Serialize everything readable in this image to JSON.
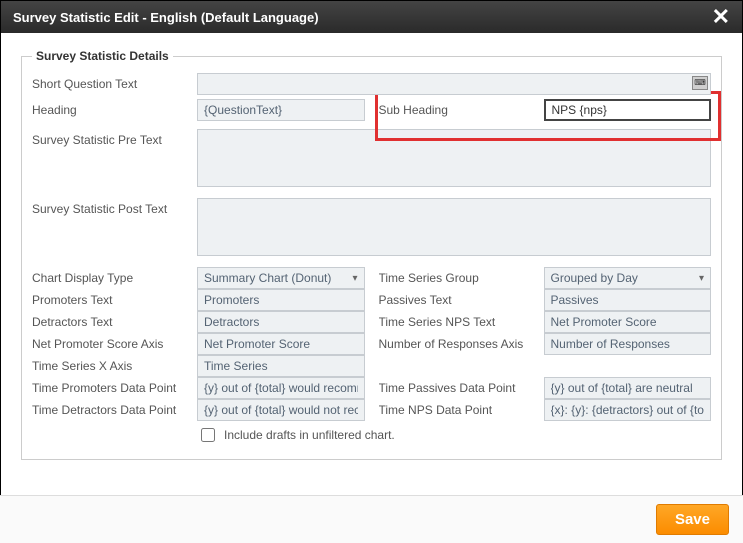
{
  "window": {
    "title": "Survey Statistic Edit  -  English (Default Language)"
  },
  "fieldset": {
    "legend": "Survey Statistic Details"
  },
  "labels": {
    "shortQuestion": "Short Question Text",
    "heading": "Heading",
    "subHeading": "Sub Heading",
    "preText": "Survey Statistic Pre Text",
    "postText": "Survey Statistic Post Text",
    "chartDisplayType": "Chart Display Type",
    "timeSeriesGroup": "Time Series Group",
    "promotersText": "Promoters Text",
    "passivesText": "Passives Text",
    "detractorsText": "Detractors Text",
    "timeSeriesNpsText": "Time Series NPS Text",
    "npsAxis": "Net Promoter Score Axis",
    "numResponsesAxis": "Number of Responses Axis",
    "timeSeriesXAxis": "Time Series X Axis",
    "timePromotersDP": "Time Promoters Data Point",
    "timePassivesDP": "Time Passives Data Point",
    "timeDetractorsDP": "Time Detractors Data Point",
    "timeNpsDP": "Time NPS Data Point",
    "includeDrafts": "Include drafts in unfiltered chart."
  },
  "values": {
    "shortQuestion": "",
    "heading": "{QuestionText}",
    "subHeading": "NPS {nps}",
    "preText": "",
    "postText": "",
    "chartDisplayType": "Summary Chart (Donut)",
    "timeSeriesGroup": "Grouped by Day",
    "promotersText": "Promoters",
    "passivesText": "Passives",
    "detractorsText": "Detractors",
    "timeSeriesNpsText": "Net Promoter Score",
    "npsAxis": "Net Promoter Score",
    "numResponsesAxis": "Number of Responses",
    "timeSeriesXAxis": "Time Series",
    "timePromotersDP": "{y} out of {total} would recommend us",
    "timePassivesDP": "{y} out of {total} are neutral",
    "timeDetractorsDP": "{y} out of {total} would not recommend",
    "timeNpsDP": "{x}: {y}: {detractors} out of {total} would"
  },
  "footer": {
    "save": "Save"
  }
}
